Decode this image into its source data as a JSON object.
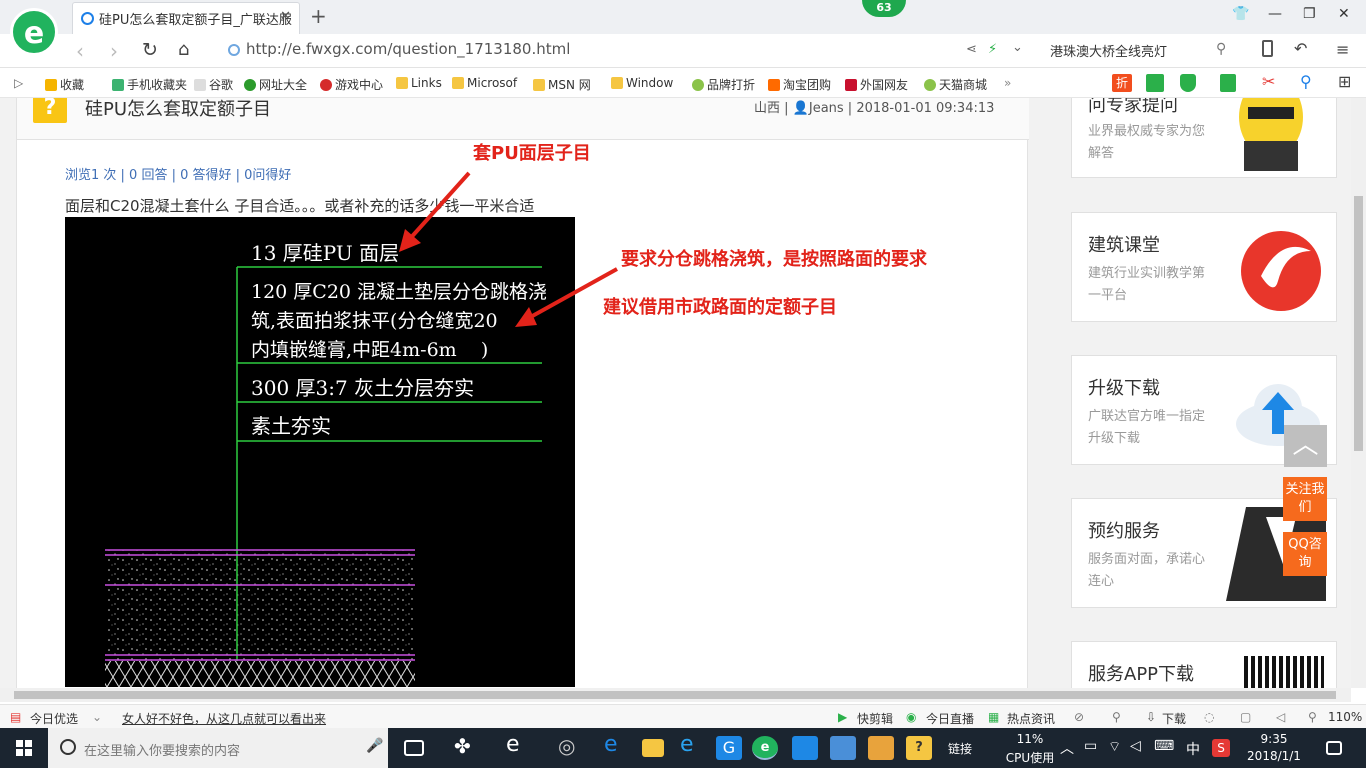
{
  "browser": {
    "tab_title": "硅PU怎么套取定额子目_广联达服",
    "new_tab": "+",
    "badge": "63",
    "url": "http://e.fwxgx.com/question_1713180.html",
    "search_text": "港珠澳大桥全线亮灯",
    "bookmarks": [
      "收藏",
      "手机收藏夹",
      "谷歌",
      "网址大全",
      "游戏中心",
      "Links",
      "Microsof",
      "MSN 网",
      "Window",
      "品牌打折",
      "淘宝团购",
      "外国网友",
      "天猫商城"
    ]
  },
  "question": {
    "title": "硅PU怎么套取定额子目",
    "region": "山西",
    "user": "Jeans",
    "datetime": "2018-01-01 09:34:13",
    "stats": "浏览1 次 | 0 回答 | 0 答得好 | 0问得好",
    "body": "面层和C20混凝土套什么 子目合适。。。或者补充的话多少钱一平米合适"
  },
  "drawing": {
    "line1": "13 厚硅PU 面层",
    "line2a": "120 厚C20 混凝土垫层分仓跳格浇",
    "line2b": "筑,表面拍浆抹平(分仓缝宽20",
    "line2c": "内填嵌缝膏,中距4m-6m    )",
    "line3": "300 厚3:7 灰土分层夯实",
    "line4": "素土夯实"
  },
  "annotations": {
    "a1": "套PU面层子目",
    "a2": "要求分仓跳格浇筑，是按照路面的要求",
    "a3": "建议借用市政路面的定额子目"
  },
  "sidebar": [
    {
      "title": "问专家提问",
      "sub": "业界最权威专家为您解答"
    },
    {
      "title": "建筑课堂",
      "sub": "建筑行业实训教学第一平台"
    },
    {
      "title": "升级下载",
      "sub": "广联达官方唯一指定升级下载"
    },
    {
      "title": "预约服务",
      "sub": "服务面对面，承诺心连心"
    },
    {
      "title": "服务APP下载",
      "sub": ""
    }
  ],
  "float": {
    "follow": "关注我们",
    "qq": "QQ咨询"
  },
  "statusbar": {
    "left1": "今日优选",
    "left2": "女人好不好色，从这几点就可以看出来",
    "r1": "快剪辑",
    "r2": "今日直播",
    "r3": "热点资讯",
    "r4": "下载",
    "zoom": "110%"
  },
  "taskbar": {
    "search_placeholder": "在这里输入你要搜索的内容",
    "links": "链接",
    "cpu_pct": "11%",
    "cpu_label": "CPU使用",
    "ime": "中",
    "time": "9:35",
    "date": "2018/1/1"
  }
}
